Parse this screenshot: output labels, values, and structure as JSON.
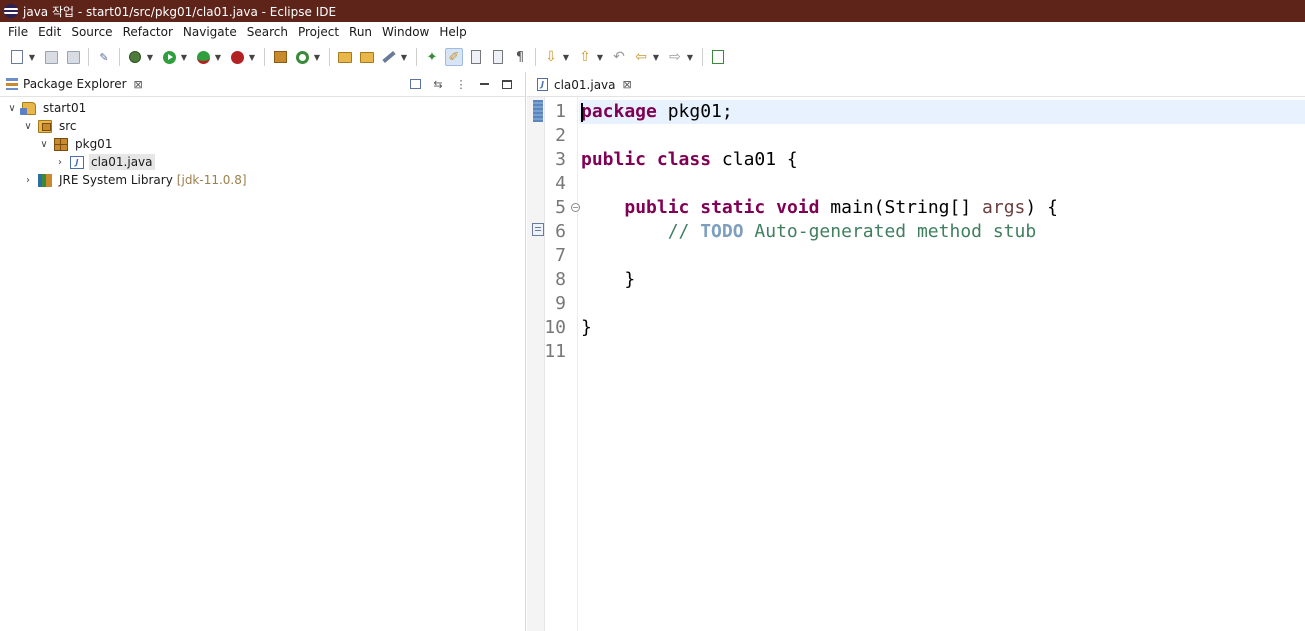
{
  "window": {
    "title": "java 작업 - start01/src/pkg01/cla01.java - Eclipse IDE"
  },
  "menubar": {
    "items": [
      "File",
      "Edit",
      "Source",
      "Refactor",
      "Navigate",
      "Search",
      "Project",
      "Run",
      "Window",
      "Help"
    ]
  },
  "toolbar": {
    "icons": [
      "new-wizard-icon",
      "save-icon",
      "save-all-icon",
      "skip-breakpoints-icon",
      "debug-icon",
      "run-icon",
      "coverage-icon",
      "external-tools-icon",
      "new-java-package-icon",
      "new-java-class-icon",
      "open-type-icon",
      "open-task-icon",
      "search-icon",
      "toggle-mark-occurrences-icon",
      "toggle-highlight-icon",
      "block-selection-icon",
      "show-whitespace-icon",
      "next-annotation-icon",
      "previous-annotation-icon",
      "last-edit-location-icon",
      "back-icon",
      "forward-icon",
      "open-perspective-icon"
    ]
  },
  "package_explorer": {
    "tab_label": "Package Explorer",
    "close_glyph": "⊠",
    "tree": [
      {
        "label": "start01",
        "level": 0,
        "expanded": true,
        "icon": "java-project-icon"
      },
      {
        "label": "src",
        "level": 1,
        "expanded": true,
        "icon": "source-folder-icon"
      },
      {
        "label": "pkg01",
        "level": 2,
        "expanded": true,
        "icon": "package-icon"
      },
      {
        "label": "cla01.java",
        "level": 3,
        "expanded": false,
        "icon": "java-file-icon",
        "selected": true
      },
      {
        "label": "JRE System Library",
        "decoration": "[jdk-11.0.8]",
        "level": 1,
        "expanded": false,
        "icon": "library-icon"
      }
    ]
  },
  "editor": {
    "tab_label": "cla01.java",
    "close_glyph": "⊠",
    "line_numbers": [
      "1",
      "2",
      "3",
      "4",
      "5",
      "6",
      "7",
      "8",
      "9",
      "10",
      "11"
    ],
    "lines": [
      {
        "tokens": [
          {
            "t": "package",
            "c": "kw"
          },
          {
            "t": " pkg01;",
            "c": ""
          }
        ]
      },
      {
        "tokens": []
      },
      {
        "tokens": [
          {
            "t": "public",
            "c": "kw"
          },
          {
            "t": " ",
            "c": ""
          },
          {
            "t": "class",
            "c": "kw"
          },
          {
            "t": " cla01 {",
            "c": ""
          }
        ]
      },
      {
        "tokens": []
      },
      {
        "tokens": [
          {
            "t": "    ",
            "c": ""
          },
          {
            "t": "public",
            "c": "kw"
          },
          {
            "t": " ",
            "c": ""
          },
          {
            "t": "static",
            "c": "kw"
          },
          {
            "t": " ",
            "c": ""
          },
          {
            "t": "void",
            "c": "kw"
          },
          {
            "t": " main(String[] ",
            "c": ""
          },
          {
            "t": "args",
            "c": "param"
          },
          {
            "t": ") {",
            "c": ""
          }
        ]
      },
      {
        "tokens": [
          {
            "t": "        ",
            "c": ""
          },
          {
            "t": "// ",
            "c": "cmt"
          },
          {
            "t": "TODO",
            "c": "todo"
          },
          {
            "t": " Auto-generated method stub",
            "c": "cmt"
          }
        ]
      },
      {
        "tokens": []
      },
      {
        "tokens": [
          {
            "t": "    }",
            "c": ""
          }
        ]
      },
      {
        "tokens": []
      },
      {
        "tokens": [
          {
            "t": "}",
            "c": ""
          }
        ]
      },
      {
        "tokens": []
      }
    ],
    "current_line": 1,
    "fold_lines": [
      5
    ]
  }
}
